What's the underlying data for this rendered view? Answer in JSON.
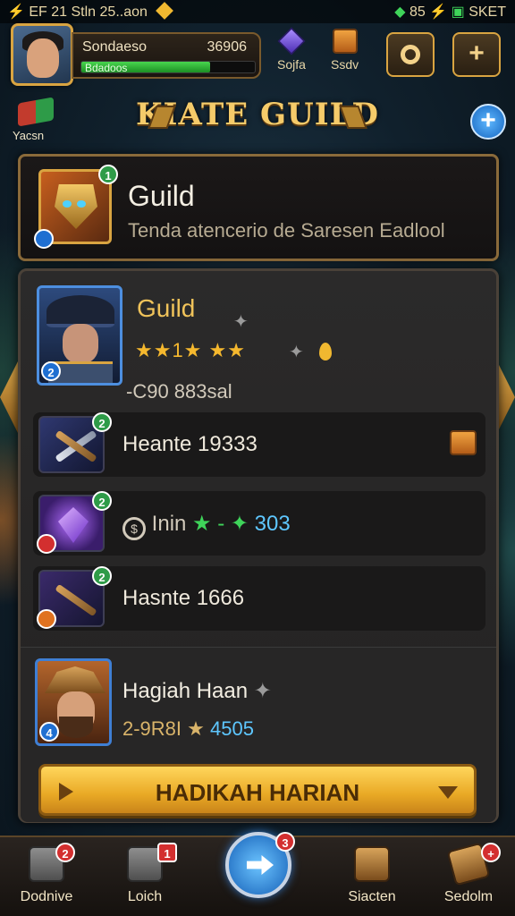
{
  "status_bar": {
    "left_text": "EF 21 Stln 25..aon",
    "right_text": "85",
    "right_label": "SKET"
  },
  "player": {
    "name": "Sondaeso",
    "power": "36906",
    "xp_label": "Bdadoos",
    "xp_progress": 0.74
  },
  "currencies": [
    {
      "label": "Sojfa",
      "icon": "purple-gem-icon"
    },
    {
      "label": "Ssdv",
      "icon": "chest-icon"
    }
  ],
  "header_buttons": [
    {
      "icon": "refresh-icon"
    },
    {
      "icon": "plus-icon",
      "glyph": "+"
    }
  ],
  "side_banner": {
    "label": "Yacsn"
  },
  "page_title": "KIATE GUILD",
  "title_plus": "+",
  "guild": {
    "name": "Guild",
    "description": "Tenda atencerio de Saresen Eadlool",
    "badge_top": "1"
  },
  "hero": {
    "name": "Guild",
    "stars": "★★1★ ★★",
    "power": "-C90 883sal",
    "badge": "2"
  },
  "rows": [
    {
      "label": "Heante 19333",
      "badge": "2",
      "icon": "crossed-swords-icon"
    },
    {
      "prefix_glyph": "$",
      "label": "Inin",
      "sep": "★ - ✦",
      "value": "303",
      "badge": "2",
      "icon": "crystal-icon"
    },
    {
      "label": "Hasnte 1666",
      "badge": "2",
      "icon": "spear-icon"
    }
  ],
  "reward": {
    "name": "Hagiah Haan",
    "stats_prefix": "2-9R8I ★",
    "stats_value": "4505",
    "badge": "4",
    "cta": "HADIKAH HARIAN"
  },
  "nav": [
    {
      "label": "Dodnive",
      "badge": "2",
      "icon": "stone-box-icon"
    },
    {
      "label": "Loich",
      "badge": "1",
      "icon": "stone-crate-icon"
    },
    {
      "label": "",
      "badge": "3",
      "icon": "arrow-right-icon"
    },
    {
      "label": "Siacten",
      "badge": "",
      "icon": "gold-chest-icon"
    },
    {
      "label": "Sedolm",
      "badge": "+",
      "icon": "scroll-icon"
    }
  ],
  "colors": {
    "accent_gold": "#d9a441",
    "xp_green": "#48d64e",
    "cta_gold": "#e9a925",
    "badge_red": "#d32f2f",
    "badge_green": "#2e9b48",
    "highlight_blue": "#5ec7ff"
  }
}
